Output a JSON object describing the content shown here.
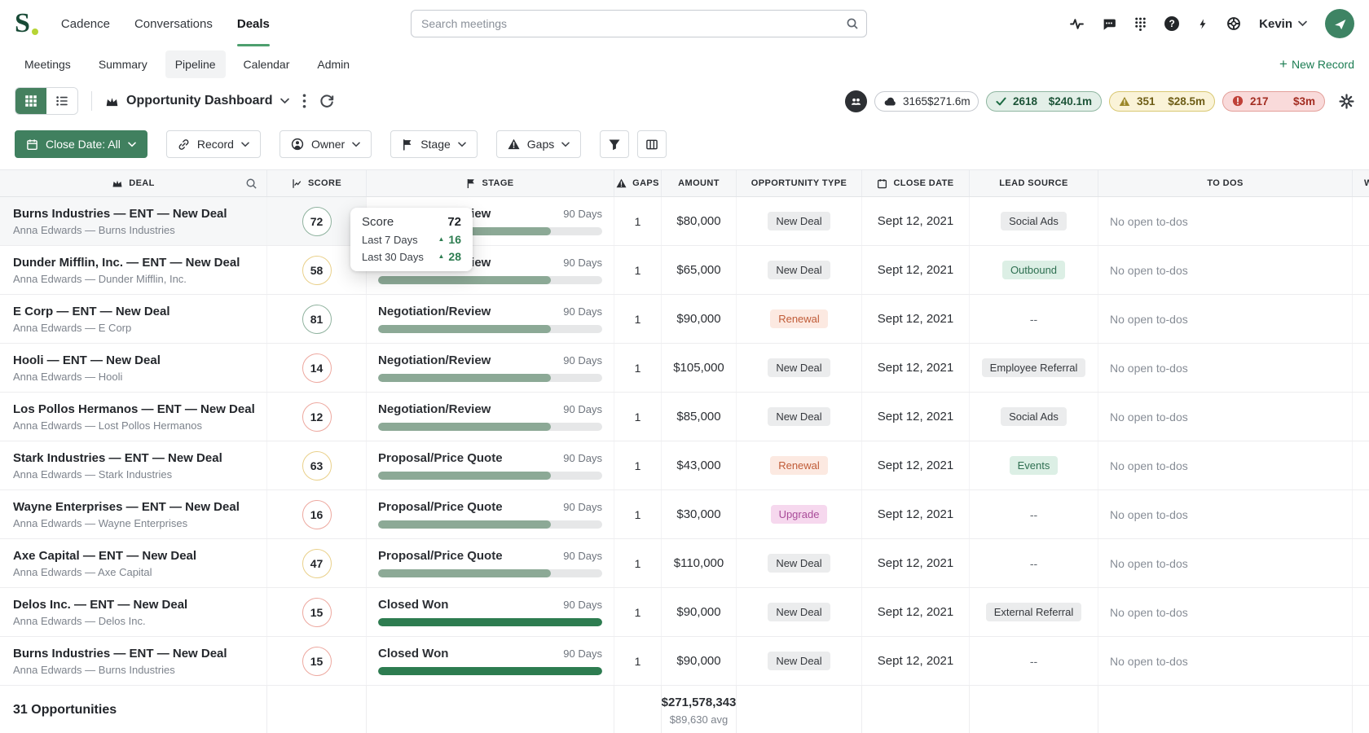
{
  "brand": {
    "logo_letter": "S"
  },
  "topnav": {
    "items": [
      {
        "label": "Cadence"
      },
      {
        "label": "Conversations"
      },
      {
        "label": "Deals"
      }
    ],
    "active": "Deals",
    "search_placeholder": "Search meetings",
    "user_name": "Kevin"
  },
  "subnav": {
    "items": [
      {
        "label": "Meetings"
      },
      {
        "label": "Summary"
      },
      {
        "label": "Pipeline"
      },
      {
        "label": "Calendar"
      },
      {
        "label": "Admin"
      }
    ],
    "active": "Pipeline",
    "new_record_label": "New Record"
  },
  "toolbar": {
    "dashboard_title": "Opportunity Dashboard",
    "stats": [
      {
        "variant": "total",
        "count": "3165",
        "amount": "$271.6m"
      },
      {
        "variant": "success",
        "count": "2618",
        "amount": "$240.1m"
      },
      {
        "variant": "warning",
        "count": "351",
        "amount": "$28.5m"
      },
      {
        "variant": "danger",
        "count": "217",
        "amount": "$3m"
      }
    ]
  },
  "filters": {
    "close_date_label": "Close Date: All",
    "record_label": "Record",
    "owner_label": "Owner",
    "stage_label": "Stage",
    "gaps_label": "Gaps"
  },
  "table": {
    "headers": {
      "deal": "DEAL",
      "score": "SCORE",
      "stage": "STAGE",
      "gaps": "GAPS",
      "amount": "AMOUNT",
      "opportunity_type": "OPPORTUNITY TYPE",
      "close_date": "CLOSE DATE",
      "lead_source": "LEAD SOURCE",
      "todos": "TO DOS",
      "partial": "W"
    },
    "rows": [
      {
        "title": "Burns Industries — ENT — New Deal",
        "subtitle": "Anna Edwards — Burns Industries",
        "score": "72",
        "score_color": "green",
        "stage": "Negotiation/Review",
        "days": "90 Days",
        "progress": 77,
        "won": false,
        "gaps": "1",
        "amount": "$80,000",
        "type": "New Deal",
        "type_variant": "gray",
        "date": "Sept 12, 2021",
        "lead": "Social Ads",
        "lead_variant": "gray",
        "todos": "No open to-dos",
        "hovered": true
      },
      {
        "title": "Dunder Mifflin, Inc. — ENT — New Deal",
        "subtitle": "Anna Edwards — Dunder Mifflin, Inc.",
        "score": "58",
        "score_color": "yellow",
        "stage": "Negotiation/Review",
        "days": "90 Days",
        "progress": 77,
        "won": false,
        "gaps": "1",
        "amount": "$65,000",
        "type": "New Deal",
        "type_variant": "gray",
        "date": "Sept 12, 2021",
        "lead": "Outbound",
        "lead_variant": "mint",
        "todos": "No open to-dos",
        "hovered": false
      },
      {
        "title": "E Corp — ENT — New Deal",
        "subtitle": "Anna Edwards — E Corp",
        "score": "81",
        "score_color": "green",
        "stage": "Negotiation/Review",
        "days": "90 Days",
        "progress": 77,
        "won": false,
        "gaps": "1",
        "amount": "$90,000",
        "type": "Renewal",
        "type_variant": "renewal",
        "date": "Sept 12, 2021",
        "lead": "--",
        "lead_variant": "none",
        "todos": "No open to-dos",
        "hovered": false
      },
      {
        "title": "Hooli — ENT — New Deal",
        "subtitle": "Anna Edwards — Hooli",
        "score": "14",
        "score_color": "red",
        "stage": "Negotiation/Review",
        "days": "90 Days",
        "progress": 77,
        "won": false,
        "gaps": "1",
        "amount": "$105,000",
        "type": "New Deal",
        "type_variant": "gray",
        "date": "Sept 12, 2021",
        "lead": "Employee Referral",
        "lead_variant": "gray",
        "todos": "No open to-dos",
        "hovered": false
      },
      {
        "title": "Los Pollos Hermanos — ENT — New Deal",
        "subtitle": "Anna Edwards — Lost Pollos Hermanos",
        "score": "12",
        "score_color": "red",
        "stage": "Negotiation/Review",
        "days": "90 Days",
        "progress": 77,
        "won": false,
        "gaps": "1",
        "amount": "$85,000",
        "type": "New Deal",
        "type_variant": "gray",
        "date": "Sept 12, 2021",
        "lead": "Social Ads",
        "lead_variant": "gray",
        "todos": "No open to-dos",
        "hovered": false
      },
      {
        "title": "Stark Industries — ENT — New Deal",
        "subtitle": "Anna Edwards — Stark Industries",
        "score": "63",
        "score_color": "yellow",
        "stage": "Proposal/Price Quote",
        "days": "90 Days",
        "progress": 77,
        "won": false,
        "gaps": "1",
        "amount": "$43,000",
        "type": "Renewal",
        "type_variant": "renewal",
        "date": "Sept 12, 2021",
        "lead": "Events",
        "lead_variant": "mint",
        "todos": "No open to-dos",
        "hovered": false
      },
      {
        "title": "Wayne Enterprises — ENT — New Deal",
        "subtitle": "Anna Edwards — Wayne Enterprises",
        "score": "16",
        "score_color": "red",
        "stage": "Proposal/Price Quote",
        "days": "90 Days",
        "progress": 77,
        "won": false,
        "gaps": "1",
        "amount": "$30,000",
        "type": "Upgrade",
        "type_variant": "upgrade",
        "date": "Sept 12, 2021",
        "lead": "--",
        "lead_variant": "none",
        "todos": "No open to-dos",
        "hovered": false
      },
      {
        "title": "Axe Capital — ENT — New Deal",
        "subtitle": "Anna Edwards — Axe Capital",
        "score": "47",
        "score_color": "yellow",
        "stage": "Proposal/Price Quote",
        "days": "90 Days",
        "progress": 77,
        "won": false,
        "gaps": "1",
        "amount": "$110,000",
        "type": "New Deal",
        "type_variant": "gray",
        "date": "Sept 12, 2021",
        "lead": "--",
        "lead_variant": "none",
        "todos": "No open to-dos",
        "hovered": false
      },
      {
        "title": "Delos Inc. — ENT — New Deal",
        "subtitle": "Anna Edwards — Delos Inc.",
        "score": "15",
        "score_color": "red",
        "stage": "Closed Won",
        "days": "90 Days",
        "progress": 100,
        "won": true,
        "gaps": "1",
        "amount": "$90,000",
        "type": "New Deal",
        "type_variant": "gray",
        "date": "Sept 12, 2021",
        "lead": "External Referral",
        "lead_variant": "gray",
        "todos": "No open to-dos",
        "hovered": false
      },
      {
        "title": "Burns Industries — ENT — New Deal",
        "subtitle": "Anna Edwards — Burns Industries",
        "score": "15",
        "score_color": "red",
        "stage": "Closed Won",
        "days": "90 Days",
        "progress": 100,
        "won": true,
        "gaps": "1",
        "amount": "$90,000",
        "type": "New Deal",
        "type_variant": "gray",
        "date": "Sept 12, 2021",
        "lead": "--",
        "lead_variant": "none",
        "todos": "No open to-dos",
        "hovered": false
      }
    ]
  },
  "tooltip": {
    "title": "Score",
    "value": "72",
    "rows": [
      {
        "label": "Last 7 Days",
        "delta": "16"
      },
      {
        "label": "Last 30 Days",
        "delta": "28"
      }
    ]
  },
  "footer": {
    "count_label": "31 Opportunities",
    "amount_total": "$271,578,343",
    "amount_avg": "$89,630 avg"
  },
  "icons": {
    "help_glyph": "?",
    "plus_glyph": "+",
    "up_glyph": "▲"
  },
  "colors": {
    "accent_green": "#40805F",
    "logo_green": "#184A36",
    "logo_dot": "#B6D435",
    "nav_underline": "#4D9F6E",
    "bar_open": "#8CA996",
    "bar_won": "#2D7C50",
    "bar_track": "#E6E7E8",
    "score_green": "#8FB29E",
    "score_yellow": "#E9D08A",
    "score_red": "#EDA89F",
    "pill_success_bg": "#E3EFE8",
    "pill_warning_bg": "#FAF3D8",
    "pill_danger_bg": "#F9DADA",
    "badge_gray_bg": "#EBECED",
    "badge_renewal_bg": "#FCE9E1",
    "badge_upgrade_bg": "#F6D8EE",
    "badge_mint_bg": "#DCEFE5"
  }
}
